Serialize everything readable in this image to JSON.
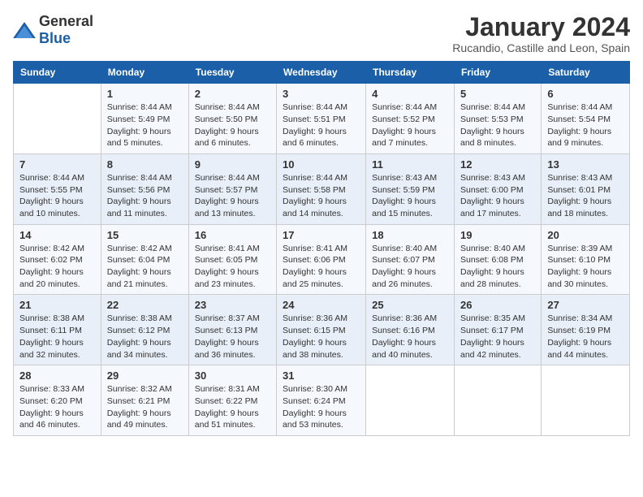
{
  "header": {
    "logo_general": "General",
    "logo_blue": "Blue",
    "title": "January 2024",
    "subtitle": "Rucandio, Castille and Leon, Spain"
  },
  "columns": [
    "Sunday",
    "Monday",
    "Tuesday",
    "Wednesday",
    "Thursday",
    "Friday",
    "Saturday"
  ],
  "weeks": [
    [
      {
        "day": "",
        "sunrise": "",
        "sunset": "",
        "daylight": ""
      },
      {
        "day": "1",
        "sunrise": "Sunrise: 8:44 AM",
        "sunset": "Sunset: 5:49 PM",
        "daylight": "Daylight: 9 hours and 5 minutes."
      },
      {
        "day": "2",
        "sunrise": "Sunrise: 8:44 AM",
        "sunset": "Sunset: 5:50 PM",
        "daylight": "Daylight: 9 hours and 6 minutes."
      },
      {
        "day": "3",
        "sunrise": "Sunrise: 8:44 AM",
        "sunset": "Sunset: 5:51 PM",
        "daylight": "Daylight: 9 hours and 6 minutes."
      },
      {
        "day": "4",
        "sunrise": "Sunrise: 8:44 AM",
        "sunset": "Sunset: 5:52 PM",
        "daylight": "Daylight: 9 hours and 7 minutes."
      },
      {
        "day": "5",
        "sunrise": "Sunrise: 8:44 AM",
        "sunset": "Sunset: 5:53 PM",
        "daylight": "Daylight: 9 hours and 8 minutes."
      },
      {
        "day": "6",
        "sunrise": "Sunrise: 8:44 AM",
        "sunset": "Sunset: 5:54 PM",
        "daylight": "Daylight: 9 hours and 9 minutes."
      }
    ],
    [
      {
        "day": "7",
        "sunrise": "Sunrise: 8:44 AM",
        "sunset": "Sunset: 5:55 PM",
        "daylight": "Daylight: 9 hours and 10 minutes."
      },
      {
        "day": "8",
        "sunrise": "Sunrise: 8:44 AM",
        "sunset": "Sunset: 5:56 PM",
        "daylight": "Daylight: 9 hours and 11 minutes."
      },
      {
        "day": "9",
        "sunrise": "Sunrise: 8:44 AM",
        "sunset": "Sunset: 5:57 PM",
        "daylight": "Daylight: 9 hours and 13 minutes."
      },
      {
        "day": "10",
        "sunrise": "Sunrise: 8:44 AM",
        "sunset": "Sunset: 5:58 PM",
        "daylight": "Daylight: 9 hours and 14 minutes."
      },
      {
        "day": "11",
        "sunrise": "Sunrise: 8:43 AM",
        "sunset": "Sunset: 5:59 PM",
        "daylight": "Daylight: 9 hours and 15 minutes."
      },
      {
        "day": "12",
        "sunrise": "Sunrise: 8:43 AM",
        "sunset": "Sunset: 6:00 PM",
        "daylight": "Daylight: 9 hours and 17 minutes."
      },
      {
        "day": "13",
        "sunrise": "Sunrise: 8:43 AM",
        "sunset": "Sunset: 6:01 PM",
        "daylight": "Daylight: 9 hours and 18 minutes."
      }
    ],
    [
      {
        "day": "14",
        "sunrise": "Sunrise: 8:42 AM",
        "sunset": "Sunset: 6:02 PM",
        "daylight": "Daylight: 9 hours and 20 minutes."
      },
      {
        "day": "15",
        "sunrise": "Sunrise: 8:42 AM",
        "sunset": "Sunset: 6:04 PM",
        "daylight": "Daylight: 9 hours and 21 minutes."
      },
      {
        "day": "16",
        "sunrise": "Sunrise: 8:41 AM",
        "sunset": "Sunset: 6:05 PM",
        "daylight": "Daylight: 9 hours and 23 minutes."
      },
      {
        "day": "17",
        "sunrise": "Sunrise: 8:41 AM",
        "sunset": "Sunset: 6:06 PM",
        "daylight": "Daylight: 9 hours and 25 minutes."
      },
      {
        "day": "18",
        "sunrise": "Sunrise: 8:40 AM",
        "sunset": "Sunset: 6:07 PM",
        "daylight": "Daylight: 9 hours and 26 minutes."
      },
      {
        "day": "19",
        "sunrise": "Sunrise: 8:40 AM",
        "sunset": "Sunset: 6:08 PM",
        "daylight": "Daylight: 9 hours and 28 minutes."
      },
      {
        "day": "20",
        "sunrise": "Sunrise: 8:39 AM",
        "sunset": "Sunset: 6:10 PM",
        "daylight": "Daylight: 9 hours and 30 minutes."
      }
    ],
    [
      {
        "day": "21",
        "sunrise": "Sunrise: 8:38 AM",
        "sunset": "Sunset: 6:11 PM",
        "daylight": "Daylight: 9 hours and 32 minutes."
      },
      {
        "day": "22",
        "sunrise": "Sunrise: 8:38 AM",
        "sunset": "Sunset: 6:12 PM",
        "daylight": "Daylight: 9 hours and 34 minutes."
      },
      {
        "day": "23",
        "sunrise": "Sunrise: 8:37 AM",
        "sunset": "Sunset: 6:13 PM",
        "daylight": "Daylight: 9 hours and 36 minutes."
      },
      {
        "day": "24",
        "sunrise": "Sunrise: 8:36 AM",
        "sunset": "Sunset: 6:15 PM",
        "daylight": "Daylight: 9 hours and 38 minutes."
      },
      {
        "day": "25",
        "sunrise": "Sunrise: 8:36 AM",
        "sunset": "Sunset: 6:16 PM",
        "daylight": "Daylight: 9 hours and 40 minutes."
      },
      {
        "day": "26",
        "sunrise": "Sunrise: 8:35 AM",
        "sunset": "Sunset: 6:17 PM",
        "daylight": "Daylight: 9 hours and 42 minutes."
      },
      {
        "day": "27",
        "sunrise": "Sunrise: 8:34 AM",
        "sunset": "Sunset: 6:19 PM",
        "daylight": "Daylight: 9 hours and 44 minutes."
      }
    ],
    [
      {
        "day": "28",
        "sunrise": "Sunrise: 8:33 AM",
        "sunset": "Sunset: 6:20 PM",
        "daylight": "Daylight: 9 hours and 46 minutes."
      },
      {
        "day": "29",
        "sunrise": "Sunrise: 8:32 AM",
        "sunset": "Sunset: 6:21 PM",
        "daylight": "Daylight: 9 hours and 49 minutes."
      },
      {
        "day": "30",
        "sunrise": "Sunrise: 8:31 AM",
        "sunset": "Sunset: 6:22 PM",
        "daylight": "Daylight: 9 hours and 51 minutes."
      },
      {
        "day": "31",
        "sunrise": "Sunrise: 8:30 AM",
        "sunset": "Sunset: 6:24 PM",
        "daylight": "Daylight: 9 hours and 53 minutes."
      },
      {
        "day": "",
        "sunrise": "",
        "sunset": "",
        "daylight": ""
      },
      {
        "day": "",
        "sunrise": "",
        "sunset": "",
        "daylight": ""
      },
      {
        "day": "",
        "sunrise": "",
        "sunset": "",
        "daylight": ""
      }
    ]
  ]
}
